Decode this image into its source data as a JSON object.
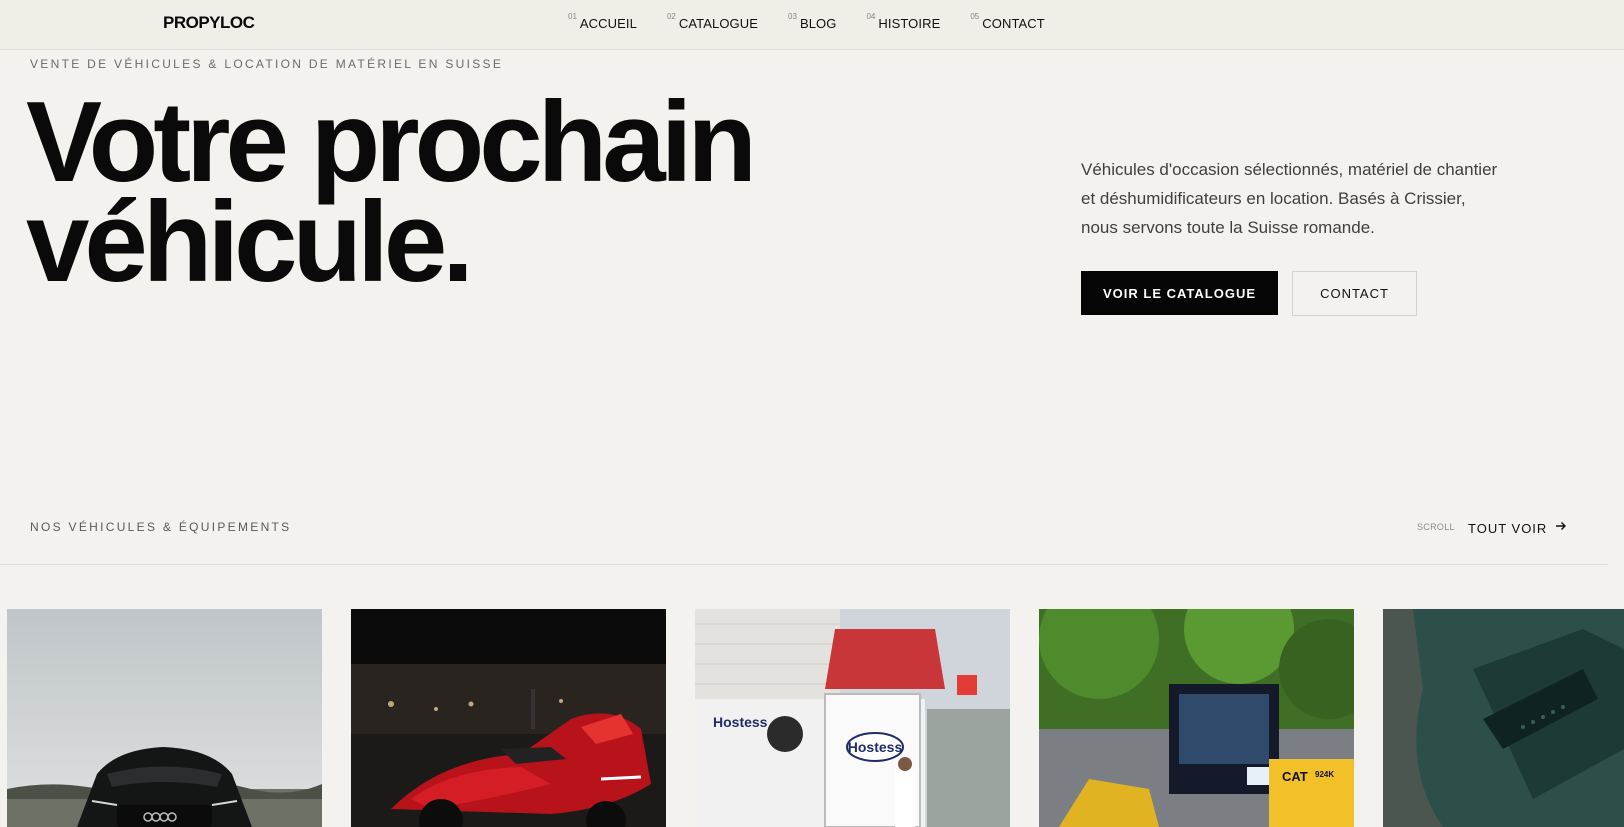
{
  "brand": {
    "logo": "PROPYLOC"
  },
  "nav": [
    {
      "num": "01",
      "label": "ACCUEIL"
    },
    {
      "num": "02",
      "label": "CATALOGUE"
    },
    {
      "num": "03",
      "label": "BLOG"
    },
    {
      "num": "04",
      "label": "HISTOIRE"
    },
    {
      "num": "05",
      "label": "CONTACT"
    }
  ],
  "hero": {
    "eyebrow": "VENTE DE VÉHICULES & LOCATION DE MATÉRIEL EN SUISSE",
    "title_line1": "Votre prochain",
    "title_line2": "véhicule.",
    "intro": "Véhicules d'occasion sélectionnés, matériel de chantier et déshumidificateurs en location. Basés à Crissier, nous servons toute la Suisse romande.",
    "primary_cta": "VOIR LE CATALOGUE",
    "secondary_cta": "CONTACT"
  },
  "listing": {
    "section_label": "NOS VÉHICULES & ÉQUIPEMENTS",
    "scroll_hint": "SCROLL",
    "see_all": "TOUT VOIR"
  },
  "cards": [
    {
      "image": "black-audi-car"
    },
    {
      "image": "red-sport-motorcycle"
    },
    {
      "image": "white-delivery-truck"
    },
    {
      "image": "yellow-cat-loader"
    },
    {
      "image": "teal-equipment-case"
    }
  ],
  "colors": {
    "accent": "#050505",
    "background": "#f4f2ef",
    "header": "#f1ede7"
  }
}
